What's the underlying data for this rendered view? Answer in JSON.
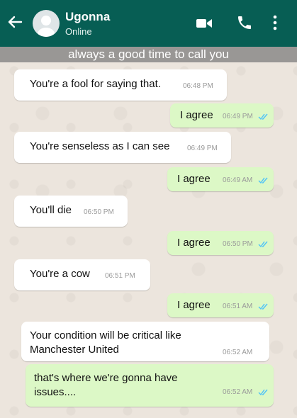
{
  "header": {
    "contact_name": "Ugonna",
    "status": "Online",
    "accent_color": "#075e54",
    "icons": [
      "back-arrow-icon",
      "avatar",
      "video-call-icon",
      "phone-icon",
      "more-options-icon"
    ]
  },
  "caption": "always a good time to call you",
  "messages": [
    {
      "direction": "incoming",
      "text": "You're a fool for saying that.",
      "time": "06:48 PM"
    },
    {
      "direction": "outgoing",
      "text": "I agree",
      "time": "06:49 PM",
      "read": true
    },
    {
      "direction": "incoming",
      "text": "You're senseless as I can see",
      "time": "06:49 PM"
    },
    {
      "direction": "outgoing",
      "text": "I agree",
      "time": "06:49 AM",
      "read": true
    },
    {
      "direction": "incoming",
      "text": "You'll die",
      "time": "06:50 PM"
    },
    {
      "direction": "outgoing",
      "text": "I agree",
      "time": "06:50 PM",
      "read": true
    },
    {
      "direction": "incoming",
      "text": "You're a cow",
      "time": "06:51 PM"
    },
    {
      "direction": "outgoing",
      "text": "I agree",
      "time": "06:51 AM",
      "read": true
    },
    {
      "direction": "incoming",
      "lines": [
        "Your condition will be critical like",
        "Manchester United"
      ],
      "time": "06:52 AM"
    },
    {
      "direction": "outgoing",
      "lines": [
        "that's where we're gonna have",
        "issues...."
      ],
      "time": "06:52 AM",
      "read": true
    }
  ]
}
